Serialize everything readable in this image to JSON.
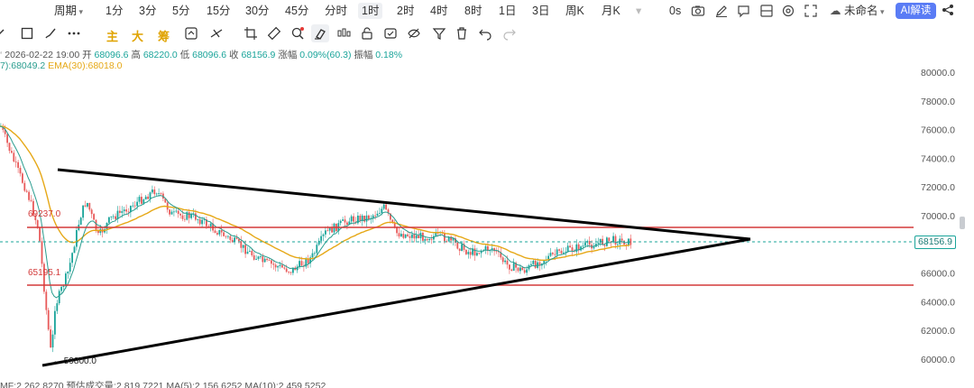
{
  "topbar": {
    "period_menu": "周期",
    "intervals": [
      "1分",
      "3分",
      "5分",
      "15分",
      "30分",
      "45分",
      "分时",
      "1时",
      "2时",
      "4时",
      "8时",
      "1日",
      "3日",
      "周K",
      "月K"
    ],
    "active_interval": "1时",
    "time_label": "0s",
    "layout_name": "未命名",
    "ai_button": "AI解读",
    "ai_color": "#5a7cf5"
  },
  "toolbar": {
    "indicator_main": "主",
    "indicator_big": "大",
    "indicator_chip": "筹",
    "indicator_color": "#e0a300"
  },
  "info": {
    "date": "2026-02-22 19:00",
    "open_label": "开",
    "open": "68096.6",
    "high_label": "高",
    "high": "68220.0",
    "low_label": "低",
    "low": "68096.6",
    "close_label": "收",
    "close": "68156.9",
    "change_label": "涨幅",
    "change": "0.09%(60.3)",
    "amplitude_label": "振幅",
    "amplitude": "0.18%",
    "ma_line": "7):68049.2",
    "ema_line": "EMA(30):68018.0"
  },
  "chart": {
    "price_axis": [
      "80000.0",
      "78000.0",
      "76000.0",
      "74000.0",
      "72000.0",
      "70000.0",
      "68000.0",
      "66000.0",
      "64000.0",
      "62000.0",
      "60000.0"
    ],
    "current_price": "68156.9",
    "resistance_label": "69237.0",
    "support_label": "65195.1",
    "low_label": "59800.0",
    "up_color": "#1aa49a",
    "down_color": "#e85a5a",
    "level_color": "#d33a3a",
    "ma_color": "#2a9d8f",
    "ema_color": "#e6a817",
    "triangle_color": "#000000"
  },
  "volume": {
    "line": "MF:2 262 8270  预估成交量:2 819 7221  MA(5):2 156 6252  MA(10):2 459 5252"
  }
}
